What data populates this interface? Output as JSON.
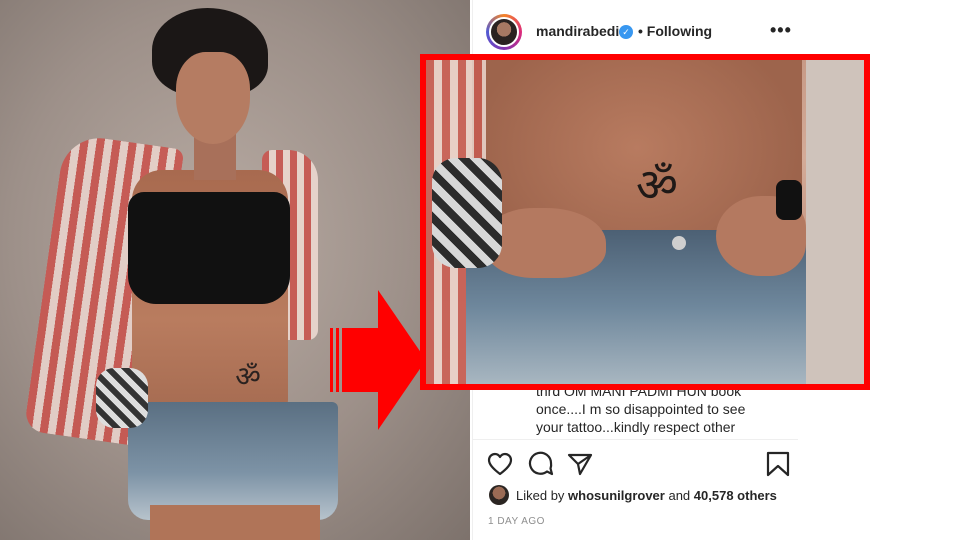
{
  "post": {
    "username": "mandirabedi",
    "verified_symbol": "✓",
    "follow_status": "• Following",
    "more_symbol": "•••",
    "caption_lines": [
      "thrd OM MANI PADMI HUN book",
      "once....I m so disappointed to see",
      "your tattoo...kindly respect other"
    ],
    "liked_by_prefix": "Liked by",
    "liked_by_user": "whosunilgrover",
    "liked_by_and": "and",
    "liked_by_count": "40,578 others",
    "timestamp": "1 DAY AGO"
  },
  "photo": {
    "tattoo_glyph": "ॐ"
  },
  "icons": {
    "like": "heart-icon",
    "comment": "comment-icon",
    "share": "share-icon",
    "save": "bookmark-icon",
    "options": "more-options-icon"
  },
  "colors": {
    "highlight": "#ff0000",
    "verified": "#3897f0",
    "text": "#262626",
    "muted": "#8e8e8e"
  }
}
